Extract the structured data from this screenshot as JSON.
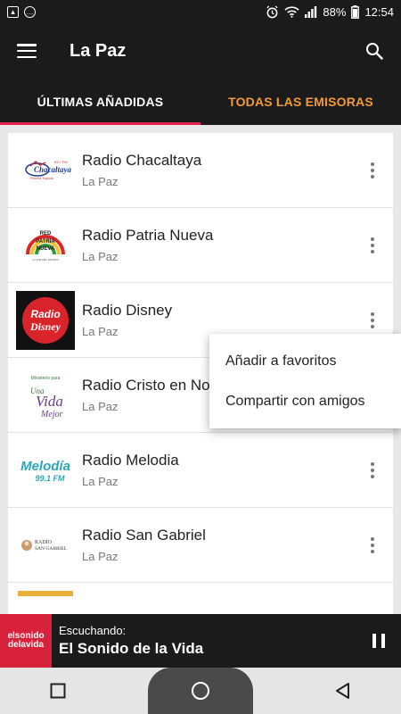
{
  "status_bar": {
    "battery": "88%",
    "time": "12:54",
    "icons": [
      "image-icon",
      "message-icon",
      "alarm-icon",
      "wifi-icon",
      "signal-icon",
      "battery-icon"
    ]
  },
  "app_bar": {
    "title": "La Paz",
    "menu_icon": "menu-icon",
    "search_icon": "search-icon"
  },
  "tabs": [
    {
      "label": "ÚLTIMAS AÑADIDAS",
      "active": true
    },
    {
      "label": "TODAS LAS EMISORAS",
      "active": false
    }
  ],
  "colors": {
    "bar_bg": "#1b1b1b",
    "tab_indicator": "#e8224f",
    "tab_inactive_text": "#f29a34"
  },
  "stations": [
    {
      "name": "Radio Chacaltaya",
      "city": "La Paz",
      "logo_text": "Chacaltaya"
    },
    {
      "name": "Radio Patria Nueva",
      "city": "La Paz",
      "logo_text": "RED PATRIA NUEVA"
    },
    {
      "name": "Radio Disney",
      "city": "La Paz",
      "logo_text": "Radio Disney"
    },
    {
      "name": "Radio Cristo en No",
      "city": "La Paz",
      "logo_text": "Una Vida Mejor"
    },
    {
      "name": "Radio Melodia",
      "city": "La Paz",
      "logo_text": "Melodía 99.1 FM"
    },
    {
      "name": "Radio San Gabriel",
      "city": "La Paz",
      "logo_text": "RADIO SAN GABRIEL"
    }
  ],
  "popup_menu": {
    "items": [
      "Añadir a favoritos",
      "Compartir con amigos"
    ]
  },
  "now_playing": {
    "label": "Escuchando:",
    "title": "El Sonido de la Vida",
    "logo_line1": "elsonido",
    "logo_line2": "delavida"
  }
}
